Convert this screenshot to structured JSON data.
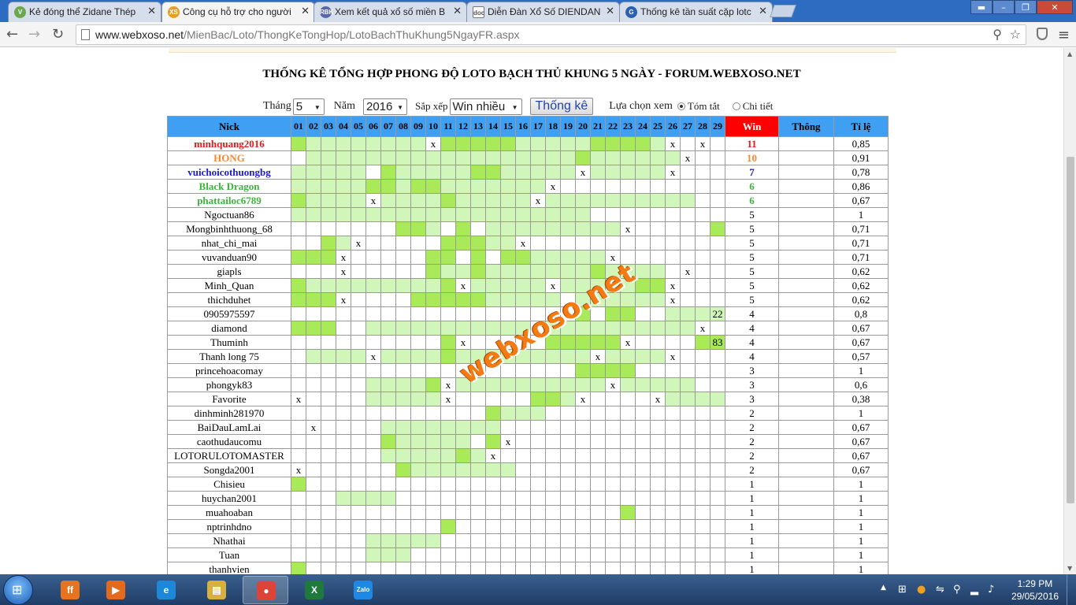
{
  "browser": {
    "tabs": [
      {
        "label": "Kẻ đóng thể Zidane Thép",
        "favicon": "V",
        "fav_color": "#6aa84f",
        "active": false
      },
      {
        "label": "Công cụ hỗ trợ cho người",
        "favicon": "XS",
        "fav_color": "#e6a01e",
        "active": true
      },
      {
        "label": "Xem kết quả xổ số miền B",
        "favicon": "RBK",
        "fav_color": "#5566aa",
        "active": false
      },
      {
        "label": "Diễn Đàn Xổ Số DIENDAN",
        "favicon": "doc",
        "fav_color": "#ffffff",
        "active": false
      },
      {
        "label": "Thống kê tần suất cặp lotc",
        "favicon": "G",
        "fav_color": "#2b5fb0",
        "active": false
      }
    ],
    "url_domain": "www.webxoso.net",
    "url_path": "/MienBac/Loto/ThongKeTongHop/LotoBachThuKhung5NgayFR.aspx"
  },
  "page": {
    "title": "THỐNG KÊ TỔNG HỢP PHONG ĐỘ LOTO BẠCH THỦ KHUNG 5 NGÀY - FORUM.WEBXOSO.NET",
    "controls": {
      "thang_label": "Tháng",
      "thang_value": "5",
      "nam_label": "Năm",
      "nam_value": "2016",
      "sapxep_label": "Sắp xếp",
      "sapxep_value": "Win nhiều",
      "button": "Thống kê",
      "view_label": "Lựa chọn xem",
      "opt1": "Tóm tắt",
      "opt2": "Chi tiết"
    },
    "watermark": "webxoso.net"
  },
  "table": {
    "headers": {
      "nick": "Nick",
      "win": "Win",
      "thong": "Thông",
      "tile": "Tỉ lệ"
    },
    "days": [
      "01",
      "02",
      "03",
      "04",
      "05",
      "06",
      "07",
      "08",
      "09",
      "10",
      "11",
      "12",
      "13",
      "14",
      "15",
      "16",
      "17",
      "18",
      "19",
      "20",
      "21",
      "22",
      "23",
      "24",
      "25",
      "26",
      "27",
      "28",
      "29"
    ],
    "rows": [
      {
        "nick": "minhquang2016",
        "color": "#e01b1b",
        "bold": true,
        "win": "11",
        "tile": "0,85",
        "cells": "12222222201111122222111120_0"
      },
      {
        "nick": "HONG",
        "color": "#f08a3a",
        "bold": true,
        "win": "10",
        "tile": "0,91",
        "cells": "_2222222222222222221222222x"
      },
      {
        "nick": "vuichoicothuongbg",
        "color": "#1a1ad6",
        "bold": true,
        "win": "7",
        "tile": "0,78",
        "cells": "22222_1222221122222x22222x"
      },
      {
        "nick": "Black Dragon",
        "color": "#3cb43c",
        "bold": true,
        "win": "6",
        "tile": "0,86",
        "cells": "22222112112222222x"
      },
      {
        "nick": "phattailoc6789",
        "color": "#3cb43c",
        "bold": true,
        "win": "6",
        "tile": "0,67",
        "cells": "12222x2222122222x2222222222"
      },
      {
        "nick": "Ngoctuan86",
        "color": "#000",
        "bold": false,
        "win": "5",
        "tile": "1",
        "cells": "22222222222222222222"
      },
      {
        "nick": "Mongbinhthuong_68",
        "color": "#000",
        "bold": false,
        "win": "5",
        "tile": "0,71",
        "cells": "_______112_1_222222222x_____1x"
      },
      {
        "nick": "nhat_chi_mai",
        "color": "#000",
        "bold": false,
        "win": "5",
        "tile": "0,71",
        "cells": "__12x_____11122x"
      },
      {
        "nick": "vuvanduan90",
        "color": "#000",
        "bold": false,
        "win": "5",
        "tile": "0,71",
        "cells": "111x_____11_1_1122222x"
      },
      {
        "nick": "giapls",
        "color": "#000",
        "bold": false,
        "win": "5",
        "tile": "0,62",
        "cells": "___x_____1221222222212222_x"
      },
      {
        "nick": "Minh_Quan",
        "color": "#000",
        "bold": false,
        "win": "5",
        "tile": "0,62",
        "cells": "12222222221x22222x2222211x"
      },
      {
        "nick": "thichduhet",
        "color": "#000",
        "bold": false,
        "win": "5",
        "tile": "0,62",
        "cells": "111x____1111122222_222222x"
      },
      {
        "nick": "0905975597",
        "color": "#000",
        "bold": false,
        "win": "4",
        "tile": "0,8",
        "cells": "___________________1_11__2222:22"
      },
      {
        "nick": "diamond",
        "color": "#000",
        "bold": false,
        "win": "4",
        "tile": "0,67",
        "cells": "111__22222222222x2222222222x"
      },
      {
        "nick": "Thuminh",
        "color": "#000",
        "bold": false,
        "win": "4",
        "tile": "0,67",
        "cells": "__________1x_____11111x____11:83"
      },
      {
        "nick": "Thanh long 75",
        "color": "#000",
        "bold": false,
        "win": "4",
        "tile": "0,57",
        "cells": "_2222x22221222222222x2222x"
      },
      {
        "nick": "princehoacomay",
        "color": "#000",
        "bold": false,
        "win": "3",
        "tile": "1",
        "cells": "___________________1111"
      },
      {
        "nick": "phongyk83",
        "color": "#000",
        "bold": false,
        "win": "3",
        "tile": "0,6",
        "cells": "_____22221x2222222222x22222"
      },
      {
        "nick": "Favorite",
        "color": "#000",
        "bold": false,
        "win": "3",
        "tile": "0,38",
        "cells": "x____22222x_____112x____x22222"
      },
      {
        "nick": "dinhminh281970",
        "color": "#000",
        "bold": false,
        "win": "2",
        "tile": "1",
        "cells": "_____________1222"
      },
      {
        "nick": "BaiDauLamLai",
        "color": "#000",
        "bold": false,
        "win": "2",
        "tile": "0,67",
        "cells": "_x____22222222"
      },
      {
        "nick": "caothudaucomu",
        "color": "#000",
        "bold": false,
        "win": "2",
        "tile": "0,67",
        "cells": "______122222_1x"
      },
      {
        "nick": "LOTORULOTOMASTER",
        "color": "#000",
        "bold": false,
        "win": "2",
        "tile": "0,67",
        "cells": "______2222212x"
      },
      {
        "nick": "Songda2001",
        "color": "#000",
        "bold": false,
        "win": "2",
        "tile": "0,67",
        "cells": "x______12222222"
      },
      {
        "nick": "Chisieu",
        "color": "#000",
        "bold": false,
        "win": "1",
        "tile": "1",
        "cells": "1"
      },
      {
        "nick": "huychan2001",
        "color": "#000",
        "bold": false,
        "win": "1",
        "tile": "1",
        "cells": "___2222"
      },
      {
        "nick": "muahoaban",
        "color": "#000",
        "bold": false,
        "win": "1",
        "tile": "1",
        "cells": "______________________1"
      },
      {
        "nick": "nptrinhdno",
        "color": "#000",
        "bold": false,
        "win": "1",
        "tile": "1",
        "cells": "__________1"
      },
      {
        "nick": "Nhathai",
        "color": "#000",
        "bold": false,
        "win": "1",
        "tile": "1",
        "cells": "_____22222"
      },
      {
        "nick": "Tuan",
        "color": "#000",
        "bold": false,
        "win": "1",
        "tile": "1",
        "cells": "_____222"
      },
      {
        "nick": "thanhvien",
        "color": "#000",
        "bold": false,
        "win": "1",
        "tile": "1",
        "cells": "1"
      }
    ]
  },
  "taskbar": {
    "apps": [
      {
        "name": "firefox-icon",
        "glyph": "ff",
        "color": "#e8731e",
        "active": false
      },
      {
        "name": "media-player-icon",
        "glyph": "▶",
        "color": "#e26a1e",
        "active": false
      },
      {
        "name": "ie-icon",
        "glyph": "e",
        "color": "#1e88d8",
        "active": false
      },
      {
        "name": "explorer-icon",
        "glyph": "▤",
        "color": "#d8b040",
        "active": false
      },
      {
        "name": "chrome-icon",
        "glyph": "●",
        "color": "#db4437",
        "active": true
      },
      {
        "name": "excel-icon",
        "glyph": "X",
        "color": "#1d7a3c",
        "active": false
      },
      {
        "name": "zalo-icon",
        "glyph": "Zalo",
        "color": "#1e88e5",
        "active": false
      }
    ],
    "time": "1:29 PM",
    "date": "29/05/2016"
  }
}
